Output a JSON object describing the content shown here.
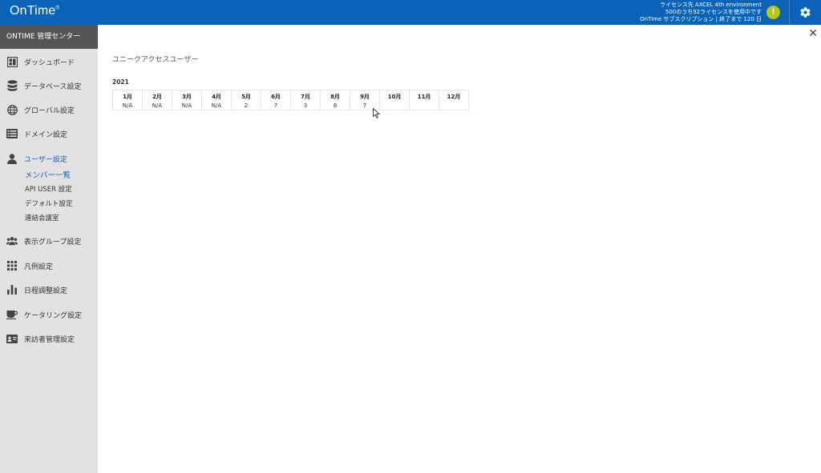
{
  "header": {
    "logo_text": "OnTime",
    "logo_mark": "®",
    "license_lines": [
      "ライセンス先 AXCEL 4th environment",
      "500のうち92ライセンスを使用中です",
      "OnTime サブスクリプション | 終了まで 120 日"
    ],
    "warning_symbol": "!",
    "brand_color": "#0b63b8",
    "warning_color": "#b7c814"
  },
  "sidebar": {
    "title": "ONTIME 管理センター",
    "items": [
      {
        "label": "ダッシュボード",
        "icon": "dashboard-icon"
      },
      {
        "label": "データベース設定",
        "icon": "database-icon"
      },
      {
        "label": "グローバル設定",
        "icon": "globe-icon"
      },
      {
        "label": "ドメイン設定",
        "icon": "domain-icon"
      },
      {
        "label": "ユーザー設定",
        "icon": "user-icon",
        "active": true
      },
      {
        "label": "表示グループ設定",
        "icon": "group-icon"
      },
      {
        "label": "凡例設定",
        "icon": "grid-icon"
      },
      {
        "label": "日程調整設定",
        "icon": "bar-chart-icon"
      },
      {
        "label": "ケータリング設定",
        "icon": "coffee-icon"
      },
      {
        "label": "来訪者管理設定",
        "icon": "visitor-card-icon"
      }
    ],
    "subitems": [
      {
        "label": "メンバー一覧",
        "active": true
      },
      {
        "label": "API USER 設定"
      },
      {
        "label": "デフォルト設定"
      },
      {
        "label": "連結会議室"
      }
    ],
    "active_color": "#1a5fb4"
  },
  "main": {
    "close_label": "✕",
    "section_title": "ユニークアクセスユーザー",
    "year": "2021",
    "months": [
      {
        "label": "1月",
        "value": "N/A"
      },
      {
        "label": "2月",
        "value": "N/A"
      },
      {
        "label": "3月",
        "value": "N/A"
      },
      {
        "label": "4月",
        "value": "N/A"
      },
      {
        "label": "5月",
        "value": "2"
      },
      {
        "label": "6月",
        "value": "7"
      },
      {
        "label": "7月",
        "value": "3"
      },
      {
        "label": "8月",
        "value": "8"
      },
      {
        "label": "9月",
        "value": "7"
      },
      {
        "label": "10月",
        "value": ""
      },
      {
        "label": "11月",
        "value": ""
      },
      {
        "label": "12月",
        "value": ""
      }
    ]
  }
}
